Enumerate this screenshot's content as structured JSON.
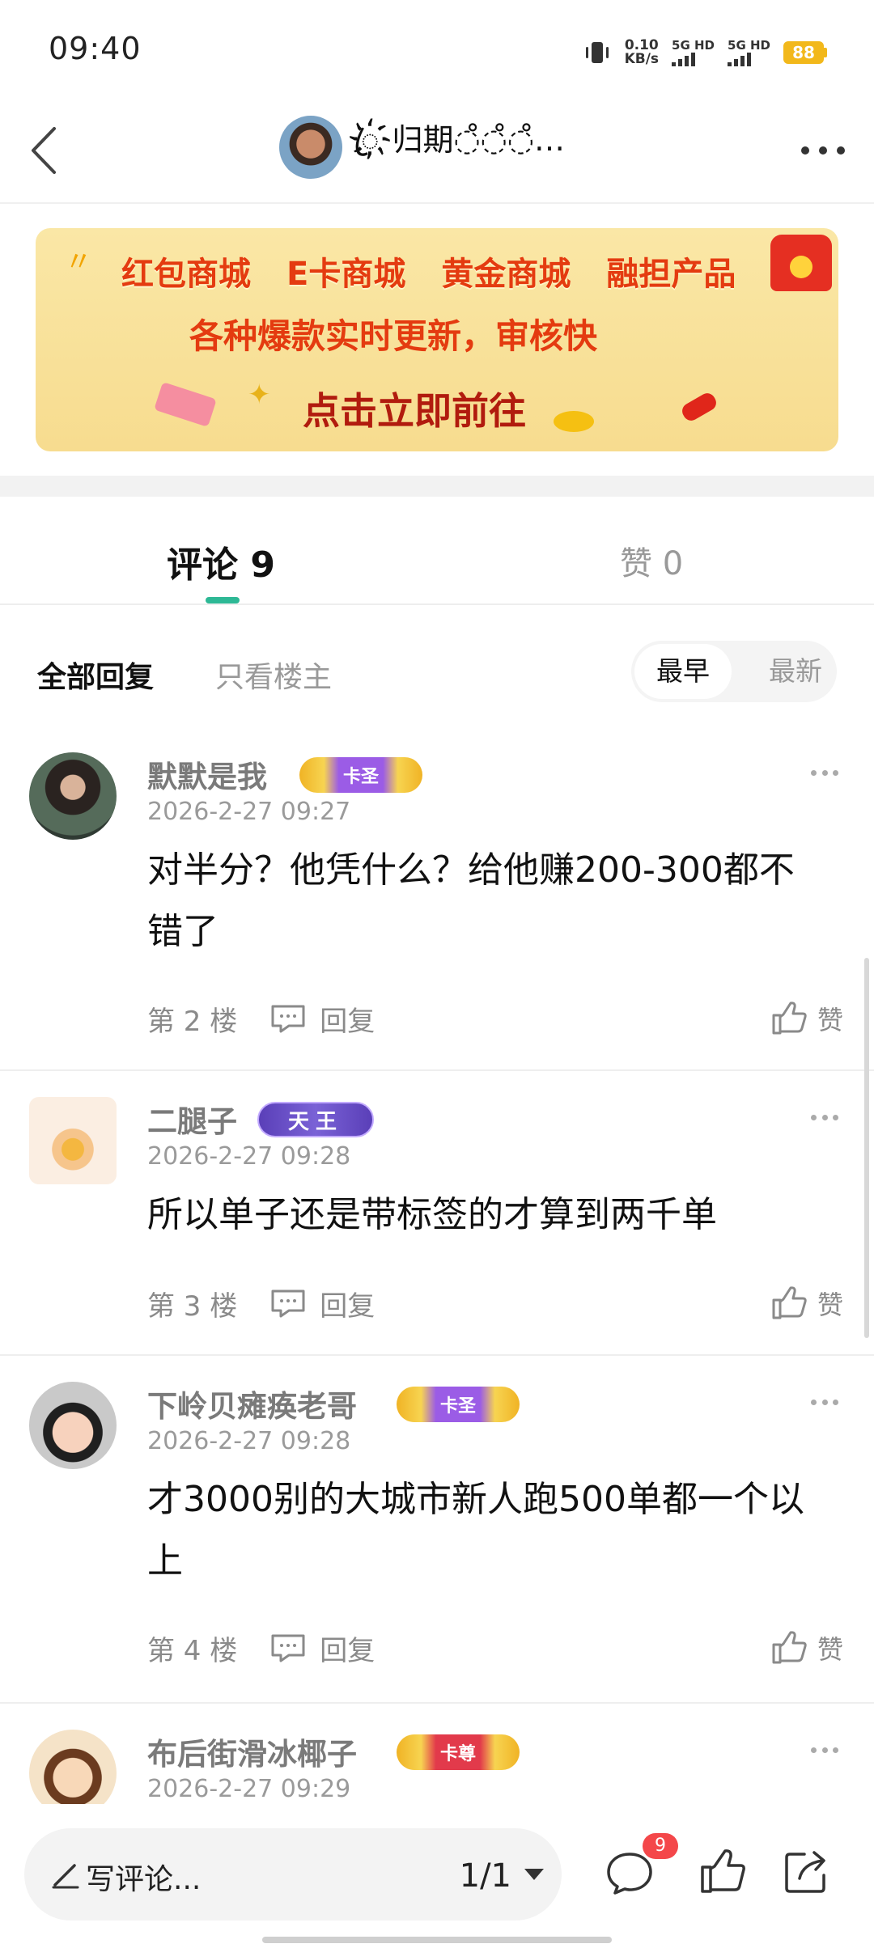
{
  "status": {
    "time": "09:40",
    "net_speed_value": "0.10",
    "net_speed_unit": "KB/s",
    "sim1_label": "5G HD",
    "sim2_label": "5G HD",
    "battery": "88",
    "battery_color": "#f2b81b"
  },
  "header": {
    "back_icon": "chevron-left-icon",
    "username": "ꦿ҉归期◌̊◌̊◌̊…",
    "more_icon": "more-horizontal-icon"
  },
  "banner": {
    "items": [
      "红包商城",
      "E卡商城",
      "黄金商城",
      "融担产品"
    ],
    "line2": "各种爆款实时更新，审核快",
    "line3": "点击立即前往"
  },
  "tabs": {
    "comments_label": "评论 9",
    "likes_label": "赞 0",
    "accent": "#2db895"
  },
  "filters": {
    "all_replies": "全部回复",
    "only_op": "只看楼主",
    "sort_earliest": "最早",
    "sort_newest": "最新"
  },
  "comments": [
    {
      "name": "默默是我",
      "badge": "卡圣",
      "time": "2026-2-27 09:27",
      "text": "对半分？他凭什么？给他赚200-300都不错了",
      "floor": "第 2 楼",
      "reply": "回复",
      "like": "赞"
    },
    {
      "name": "二腿子",
      "badge": "天王",
      "time": "2026-2-27 09:28",
      "text": "所以单子还是带标签的才算到两千单",
      "floor": "第 3 楼",
      "reply": "回复",
      "like": "赞"
    },
    {
      "name": "下岭贝瘫痪老哥",
      "badge": "卡圣",
      "time": "2026-2-27 09:28",
      "text": "才3000别的大城市新人跑500单都一个以上",
      "floor": "第 4 楼",
      "reply": "回复",
      "like": "赞"
    },
    {
      "name": "布后街滑冰椰子",
      "badge": "卡尊",
      "time": "2026-2-27 09:29"
    }
  ],
  "bottom": {
    "compose_placeholder": "写评论...",
    "page_indicator": "1/1",
    "comment_count": "9"
  }
}
